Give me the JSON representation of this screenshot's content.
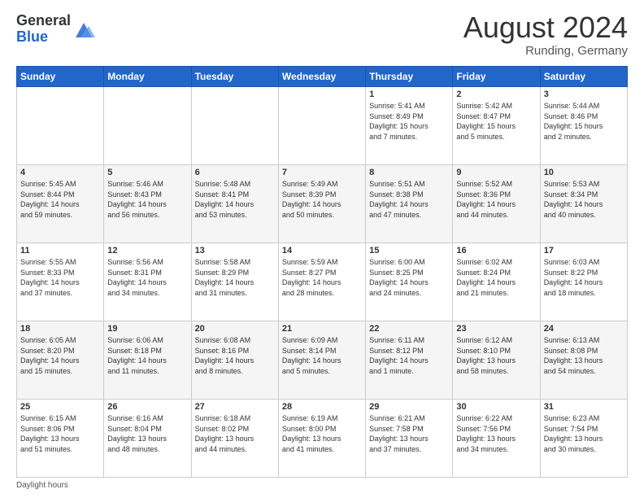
{
  "header": {
    "logo_general": "General",
    "logo_blue": "Blue",
    "month_year": "August 2024",
    "location": "Runding, Germany"
  },
  "days_of_week": [
    "Sunday",
    "Monday",
    "Tuesday",
    "Wednesday",
    "Thursday",
    "Friday",
    "Saturday"
  ],
  "weeks": [
    [
      {
        "day": "",
        "info": ""
      },
      {
        "day": "",
        "info": ""
      },
      {
        "day": "",
        "info": ""
      },
      {
        "day": "",
        "info": ""
      },
      {
        "day": "1",
        "info": "Sunrise: 5:41 AM\nSunset: 8:49 PM\nDaylight: 15 hours\nand 7 minutes."
      },
      {
        "day": "2",
        "info": "Sunrise: 5:42 AM\nSunset: 8:47 PM\nDaylight: 15 hours\nand 5 minutes."
      },
      {
        "day": "3",
        "info": "Sunrise: 5:44 AM\nSunset: 8:46 PM\nDaylight: 15 hours\nand 2 minutes."
      }
    ],
    [
      {
        "day": "4",
        "info": "Sunrise: 5:45 AM\nSunset: 8:44 PM\nDaylight: 14 hours\nand 59 minutes."
      },
      {
        "day": "5",
        "info": "Sunrise: 5:46 AM\nSunset: 8:43 PM\nDaylight: 14 hours\nand 56 minutes."
      },
      {
        "day": "6",
        "info": "Sunrise: 5:48 AM\nSunset: 8:41 PM\nDaylight: 14 hours\nand 53 minutes."
      },
      {
        "day": "7",
        "info": "Sunrise: 5:49 AM\nSunset: 8:39 PM\nDaylight: 14 hours\nand 50 minutes."
      },
      {
        "day": "8",
        "info": "Sunrise: 5:51 AM\nSunset: 8:38 PM\nDaylight: 14 hours\nand 47 minutes."
      },
      {
        "day": "9",
        "info": "Sunrise: 5:52 AM\nSunset: 8:36 PM\nDaylight: 14 hours\nand 44 minutes."
      },
      {
        "day": "10",
        "info": "Sunrise: 5:53 AM\nSunset: 8:34 PM\nDaylight: 14 hours\nand 40 minutes."
      }
    ],
    [
      {
        "day": "11",
        "info": "Sunrise: 5:55 AM\nSunset: 8:33 PM\nDaylight: 14 hours\nand 37 minutes."
      },
      {
        "day": "12",
        "info": "Sunrise: 5:56 AM\nSunset: 8:31 PM\nDaylight: 14 hours\nand 34 minutes."
      },
      {
        "day": "13",
        "info": "Sunrise: 5:58 AM\nSunset: 8:29 PM\nDaylight: 14 hours\nand 31 minutes."
      },
      {
        "day": "14",
        "info": "Sunrise: 5:59 AM\nSunset: 8:27 PM\nDaylight: 14 hours\nand 28 minutes."
      },
      {
        "day": "15",
        "info": "Sunrise: 6:00 AM\nSunset: 8:25 PM\nDaylight: 14 hours\nand 24 minutes."
      },
      {
        "day": "16",
        "info": "Sunrise: 6:02 AM\nSunset: 8:24 PM\nDaylight: 14 hours\nand 21 minutes."
      },
      {
        "day": "17",
        "info": "Sunrise: 6:03 AM\nSunset: 8:22 PM\nDaylight: 14 hours\nand 18 minutes."
      }
    ],
    [
      {
        "day": "18",
        "info": "Sunrise: 6:05 AM\nSunset: 8:20 PM\nDaylight: 14 hours\nand 15 minutes."
      },
      {
        "day": "19",
        "info": "Sunrise: 6:06 AM\nSunset: 8:18 PM\nDaylight: 14 hours\nand 11 minutes."
      },
      {
        "day": "20",
        "info": "Sunrise: 6:08 AM\nSunset: 8:16 PM\nDaylight: 14 hours\nand 8 minutes."
      },
      {
        "day": "21",
        "info": "Sunrise: 6:09 AM\nSunset: 8:14 PM\nDaylight: 14 hours\nand 5 minutes."
      },
      {
        "day": "22",
        "info": "Sunrise: 6:11 AM\nSunset: 8:12 PM\nDaylight: 14 hours\nand 1 minute."
      },
      {
        "day": "23",
        "info": "Sunrise: 6:12 AM\nSunset: 8:10 PM\nDaylight: 13 hours\nand 58 minutes."
      },
      {
        "day": "24",
        "info": "Sunrise: 6:13 AM\nSunset: 8:08 PM\nDaylight: 13 hours\nand 54 minutes."
      }
    ],
    [
      {
        "day": "25",
        "info": "Sunrise: 6:15 AM\nSunset: 8:06 PM\nDaylight: 13 hours\nand 51 minutes."
      },
      {
        "day": "26",
        "info": "Sunrise: 6:16 AM\nSunset: 8:04 PM\nDaylight: 13 hours\nand 48 minutes."
      },
      {
        "day": "27",
        "info": "Sunrise: 6:18 AM\nSunset: 8:02 PM\nDaylight: 13 hours\nand 44 minutes."
      },
      {
        "day": "28",
        "info": "Sunrise: 6:19 AM\nSunset: 8:00 PM\nDaylight: 13 hours\nand 41 minutes."
      },
      {
        "day": "29",
        "info": "Sunrise: 6:21 AM\nSunset: 7:58 PM\nDaylight: 13 hours\nand 37 minutes."
      },
      {
        "day": "30",
        "info": "Sunrise: 6:22 AM\nSunset: 7:56 PM\nDaylight: 13 hours\nand 34 minutes."
      },
      {
        "day": "31",
        "info": "Sunrise: 6:23 AM\nSunset: 7:54 PM\nDaylight: 13 hours\nand 30 minutes."
      }
    ]
  ],
  "footer": {
    "note": "Daylight hours"
  }
}
